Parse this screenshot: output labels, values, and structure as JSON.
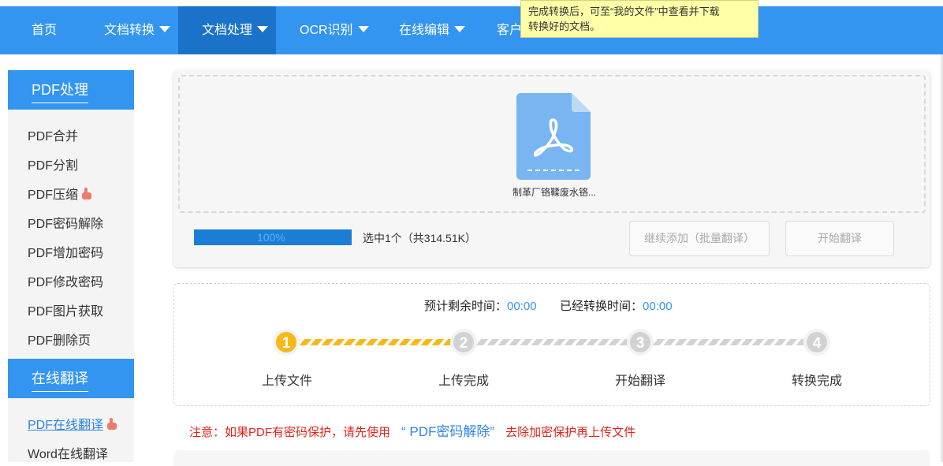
{
  "nav": {
    "items": [
      {
        "label": "首页",
        "dropdown": false,
        "active": false
      },
      {
        "label": "文档转换",
        "dropdown": true,
        "active": false
      },
      {
        "label": "文档处理",
        "dropdown": true,
        "active": true
      },
      {
        "label": "OCR识别",
        "dropdown": true,
        "active": false
      },
      {
        "label": "在线编辑",
        "dropdown": true,
        "active": false
      },
      {
        "label": "客户",
        "dropdown": false,
        "active": false
      }
    ]
  },
  "tooltip": {
    "line1": "完成转换后，可至“我的文件”中查看并下载",
    "line2": "转换好的文档。"
  },
  "sidebar": {
    "pdf_section": {
      "title": "PDF处理",
      "items": [
        {
          "label": "PDF合并",
          "hot": false
        },
        {
          "label": "PDF分割",
          "hot": false
        },
        {
          "label": "PDF压缩",
          "hot": true
        },
        {
          "label": "PDF密码解除",
          "hot": false
        },
        {
          "label": "PDF增加密码",
          "hot": false
        },
        {
          "label": "PDF修改密码",
          "hot": false
        },
        {
          "label": "PDF图片获取",
          "hot": false
        },
        {
          "label": "PDF删除页",
          "hot": false
        }
      ]
    },
    "translate_section": {
      "title": "在线翻译",
      "items": [
        {
          "label": "PDF在线翻译",
          "hot": true,
          "active": true
        },
        {
          "label": "Word在线翻译",
          "hot": false,
          "active": false
        }
      ]
    }
  },
  "upload": {
    "file_name": "制革厂铬鞣废水铬...",
    "progress_text": "100%",
    "progress_value": 1.0,
    "selection_info": "选中1个（共314.51K）",
    "continue_button": "继续添加（批量翻译）",
    "start_button": "开始翻译"
  },
  "status": {
    "remaining_label": "预计剩余时间：",
    "remaining_value": "00:00",
    "elapsed_label": "已经转换时间：",
    "elapsed_value": "00:00",
    "steps": [
      {
        "num": "1",
        "label": "上传文件",
        "done": true
      },
      {
        "num": "2",
        "label": "上传完成",
        "done": false
      },
      {
        "num": "3",
        "label": "开始翻译",
        "done": false
      },
      {
        "num": "4",
        "label": "转换完成",
        "done": false
      }
    ]
  },
  "notice": {
    "prefix": "注意：如果PDF有密码保护，请先使用",
    "link": "“ PDF密码解除”",
    "suffix": "去除加密保护再上传文件"
  },
  "colors": {
    "nav_bg": "#3395f0",
    "nav_active": "#1a73c8",
    "accent": "#3395f0",
    "progress": "#1a7fd4",
    "step_done": "#f5b918",
    "notice": "#e0251b"
  }
}
